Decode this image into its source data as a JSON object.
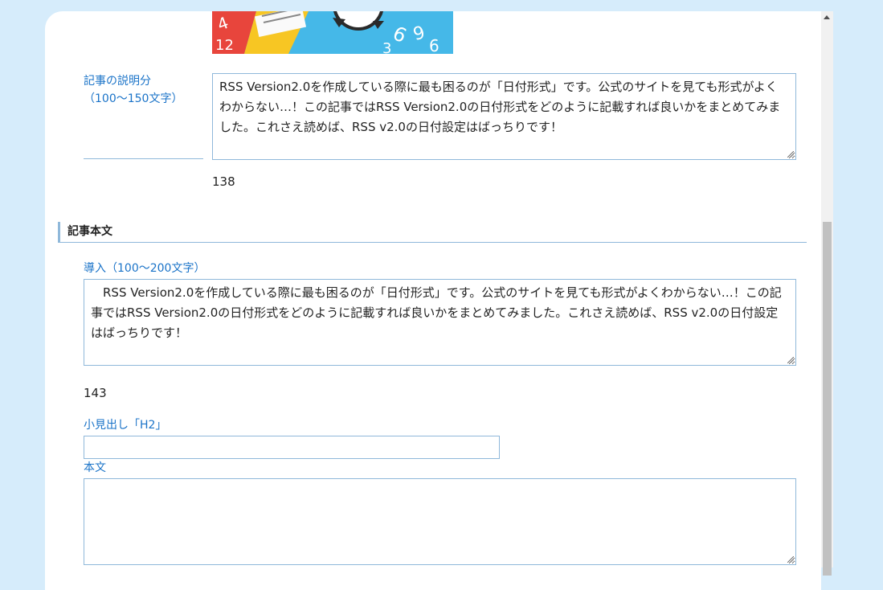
{
  "description_section": {
    "label_line1": "記事の説明分",
    "label_line2": "（100～150文字）",
    "text": "RSS Version2.0を作成している際に最も困るのが「日付形式」です。公式のサイトを見ても形式がよくわからない…！この記事ではRSS Version2.0の日付形式をどのように記載すれば良いかをまとめてみました。これさえ読めば、RSS v2.0の日付設定はばっちりです！",
    "count": "138"
  },
  "body_section": {
    "title": "記事本文",
    "intro_label": "導入（100～200文字）",
    "intro_text": "　RSS Version2.0を作成している際に最も困るのが「日付形式」です。公式のサイトを見ても形式がよくわからない…！この記事ではRSS Version2.0の日付形式をどのように記載すれば良いかをまとめてみました。これさえ読めば、RSS v2.0の日付設定はばっちりです！",
    "intro_count": "143",
    "h2_label": "小見出し「H2」",
    "h2_value": "",
    "body_label": "本文",
    "body_value": ""
  },
  "colors": {
    "page_bg": "#d6ecfb",
    "label": "#1a73c8",
    "border": "#8fb8da"
  }
}
